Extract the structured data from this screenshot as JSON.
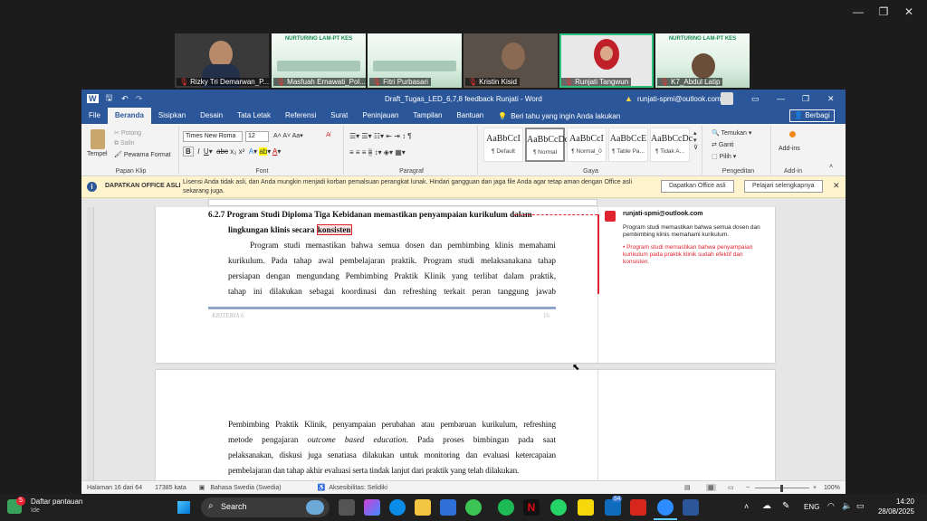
{
  "zoom": {
    "participants": [
      {
        "name": "Rizky Tri Demarwan_P..."
      },
      {
        "name": "Masfuah Ernawati_Pol..."
      },
      {
        "name": "Fitri Purbasari"
      },
      {
        "name": "Kristin Kisid"
      },
      {
        "name": "Runjati Tangwun"
      },
      {
        "name": "K7_Abdul Latip"
      }
    ],
    "banner_title": "NURTURING LAM-PT KES"
  },
  "word": {
    "title": "Draft_Tugas_LED_6,7,8 feedback Runjati  -  Word",
    "user_email": "runjati-spmi@outlook.com",
    "tabs": [
      "File",
      "Beranda",
      "Sisipkan",
      "Desain",
      "Tata Letak",
      "Referensi",
      "Surat",
      "Peninjauan",
      "Tampilan",
      "Bantuan"
    ],
    "tell_me": "Beri tahu yang ingin Anda lakukan",
    "share": "Berbagi",
    "clipboard": {
      "paste": "Tempel",
      "cut": "Potong",
      "copy": "Salin",
      "format_painter": "Pewarna Format",
      "label": "Papan Klip"
    },
    "font": {
      "name": "Times New Roma",
      "size": "12",
      "label": "Font"
    },
    "paragraph_label": "Paragraf",
    "styles": {
      "items": [
        {
          "preview": "AaBbCcI",
          "name": "¶ Default"
        },
        {
          "preview": "AaBbCcDc",
          "name": "¶ Normal"
        },
        {
          "preview": "AaBbCcI",
          "name": "¶ Normal_0"
        },
        {
          "preview": "AaBbCcE",
          "name": "¶ Table Pa..."
        },
        {
          "preview": "AaBbCcDc",
          "name": "¶ Tidak A..."
        }
      ],
      "label": "Gaya"
    },
    "editing": {
      "find": "Temukan",
      "replace": "Ganti",
      "select": "Pilih",
      "label": "Pengeditan"
    },
    "addins": {
      "btn": "Add-ins",
      "label": "Add-in"
    },
    "infobar": {
      "title": "DAPATKAN OFFICE ASLI",
      "message": "Lisensi Anda tidak asli, dan Anda mungkin menjadi korban pemalsuan perangkat lunak. Hindari gangguan dan jaga file Anda agar tetap aman dengan Office asli sekarang juga.",
      "btn1": "Dapatkan Office asli",
      "btn2": "Pelajari selengkapnya"
    },
    "document": {
      "heading_num": "6.2.7",
      "heading_line1": "Program Studi Diploma Tiga Kebidanan memastikan penyampaian kurikulum dalam",
      "heading_line2_pre": "lingkungan klinis secara ",
      "heading_highlight": "konsisten",
      "para1_line1": "Program studi memastikan bahwa semua dosen dan pembimbing klinis memahami",
      "para1_line2": "kurikulum. Pada tahap awal pembelajaran praktik. Program studi melaksanakana tahap",
      "para1_line3": "persiapan dengan mengundang Pembimbing Praktik Klinik yang terlibat dalam praktik,",
      "para1_line4": "tahap ini dilakukan sebagai koordinasi dan refreshing terkait peran tanggung jawab",
      "footer_label": "KRITERIA 6",
      "footer_page": "16",
      "para2_line1": "Pembimbing Praktik Klinik, penyampaian perubahan atau pembaruan kurikulum, refreshing",
      "para2_line2_pre": "metode pengajaran ",
      "para2_line2_italic": "outcome based education",
      "para2_line2_post": ". Pada proses bimbingan pada saat",
      "para2_line3": "pelaksanakan, diskusi juga senatiasa dilakukan untuk monitoring dan evaluasi ketercapaian",
      "para2_line4": "pembelajaran dan tahap akhir evaluasi serta tindak lanjut dari praktik yang telah dilakukan."
    },
    "comment": {
      "author": "runjati-spmi@outlook.com",
      "text": "Program studi memastikan bahwa semua dosen dan pembimbing klinis memahami kurikulum.",
      "note": "• Program studi memastikan bahwa penyampaian kurikulum pada praktik klinik sudah efektif dan konsisten."
    },
    "status": {
      "page": "Halaman 16 dari 64",
      "words": "17385 kata",
      "language": "Bahasa Swedia (Swedia)",
      "accessibility": "Aksesibilitas: Selidiki",
      "zoom": "100%"
    }
  },
  "taskbar": {
    "watchlist_title": "Daftar pantauan",
    "watchlist_sub": "Ide",
    "watchlist_badge": "5",
    "search": "Search",
    "badge_count": "54",
    "lang": "ENG",
    "time": "14:20",
    "date": "28/08/2025"
  },
  "colors": {
    "word_blue": "#2b579a",
    "comment_red": "#e0242f",
    "zoom_active": "#2ec27e"
  }
}
